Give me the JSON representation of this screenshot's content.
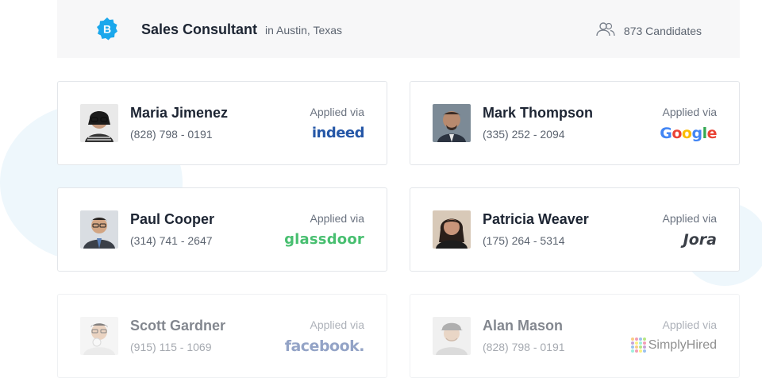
{
  "header": {
    "job_title": "Sales Consultant",
    "location": "in Austin, Texas",
    "candidate_count": "873 Candidates",
    "brand_icon": "badge-b-icon",
    "brand_color": "#1aa7ec"
  },
  "applied_via_label": "Applied via",
  "candidates": [
    {
      "name": "Maria Jimenez",
      "phone": "(828) 798 - 0191",
      "source": "indeed"
    },
    {
      "name": "Mark Thompson",
      "phone": "(335) 252 - 2094",
      "source": "Google"
    },
    {
      "name": "Paul Cooper",
      "phone": "(314) 741 - 2647",
      "source": "glassdoor"
    },
    {
      "name": "Patricia Weaver",
      "phone": "(175) 264 - 5314",
      "source": "Jora"
    },
    {
      "name": "Scott Gardner",
      "phone": "(915) 115 - 1069",
      "source": "facebook."
    },
    {
      "name": "Alan Mason",
      "phone": "(828) 798 - 0191",
      "source": "SimplyHired"
    }
  ]
}
